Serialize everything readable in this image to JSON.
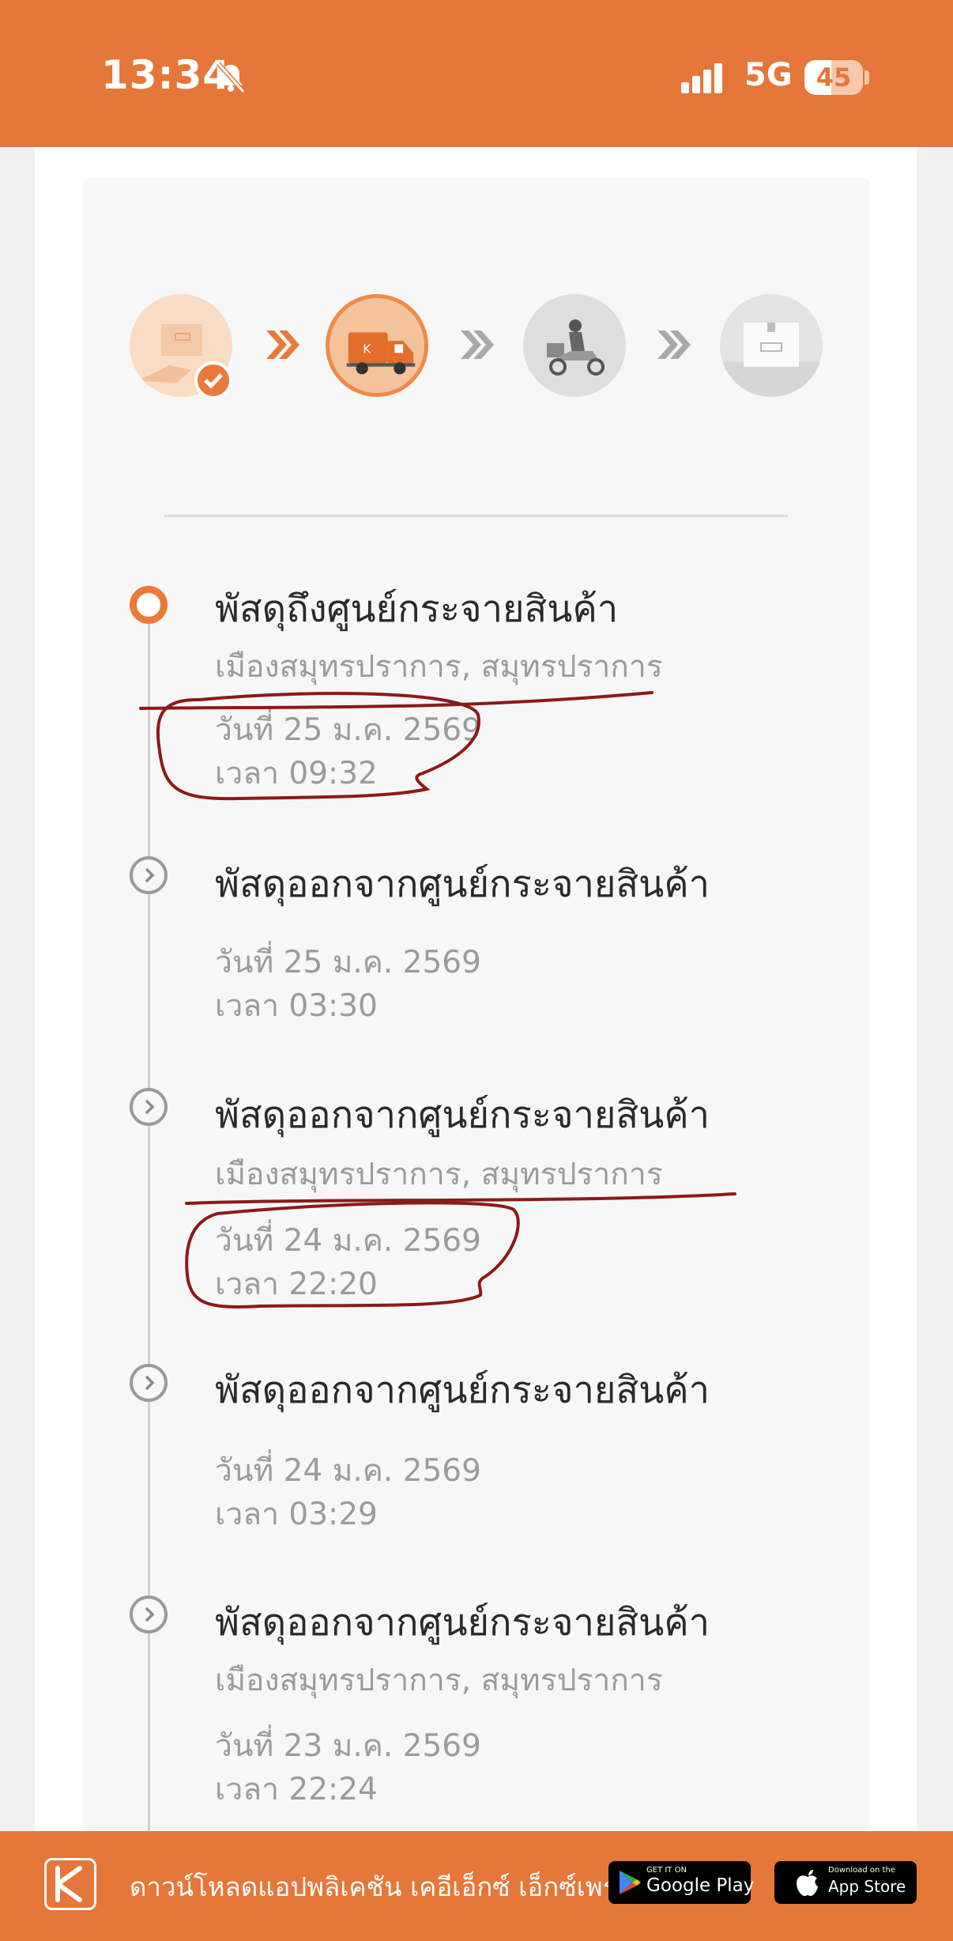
{
  "status_bar": {
    "time": "13:34",
    "network": "5G",
    "battery": "45"
  },
  "progress_steps": [
    {
      "name": "parcel-received",
      "state": "done"
    },
    {
      "name": "in-transit-truck",
      "state": "current"
    },
    {
      "name": "out-for-delivery-scooter",
      "state": "pending"
    },
    {
      "name": "delivered-box",
      "state": "pending"
    }
  ],
  "timeline": [
    {
      "title": "พัสดุถึงศูนย์กระจายสินค้า",
      "location": "เมืองสมุทรปราการ, สมุทรปราการ",
      "date": "วันที่ 25 ม.ค. 2569",
      "time": "เวลา 09:32"
    },
    {
      "title": "พัสดุออกจากศูนย์กระจายสินค้า",
      "location": "",
      "date": "วันที่ 25 ม.ค. 2569",
      "time": "เวลา 03:30"
    },
    {
      "title": "พัสดุออกจากศูนย์กระจายสินค้า",
      "location": "เมืองสมุทรปราการ, สมุทรปราการ",
      "date": "วันที่ 24 ม.ค. 2569",
      "time": "เวลา 22:20"
    },
    {
      "title": "พัสดุออกจากศูนย์กระจายสินค้า",
      "location": "",
      "date": "วันที่ 24 ม.ค. 2569",
      "time": "เวลา 03:29"
    },
    {
      "title": "พัสดุออกจากศูนย์กระจายสินค้า",
      "location": "เมืองสมุทรปราการ, สมุทรปราการ",
      "date": "วันที่ 23 ม.ค. 2569",
      "time": "เวลา 22:24"
    }
  ],
  "footer": {
    "download_text": "ดาวน์โหลดแอปพลิเคชัน เคอีเอ็กซ์ เอ็กซ์เพรส",
    "google_play": {
      "small": "GET IT ON",
      "big": "Google Play"
    },
    "app_store": {
      "small": "Download on the",
      "big": "App Store"
    }
  },
  "colors": {
    "accent": "#e5773a",
    "annotation": "#8b1a1a"
  }
}
